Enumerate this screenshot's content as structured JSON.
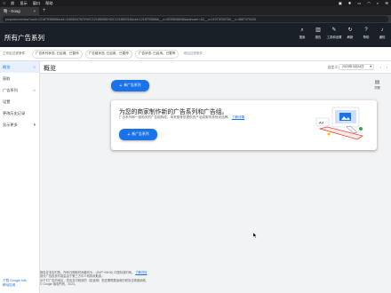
{
  "menubar": {
    "items": [
      "前",
      "显示",
      "窗口",
      "帮助"
    ]
  },
  "browser": {
    "tab_title": "略 - Goog",
    "url": "ps/pvw/overview?ocid=1218793868&euid=11608347623%2C121880581%2C121882016&cid=1218793868&__c=4039848848&authuser=1&__u=1197303476&__c=4867470426"
  },
  "app": {
    "title": "所有广告系列"
  },
  "toolbar": {
    "items": [
      {
        "icon": "search-icon",
        "label": "搜索"
      },
      {
        "icon": "reports-icon",
        "label": "报告"
      },
      {
        "icon": "tools-icon",
        "label": "工具和设置"
      },
      {
        "icon": "refresh-icon",
        "label": "刷新"
      },
      {
        "icon": "help-icon",
        "label": "帮助"
      },
      {
        "icon": "notifications-icon",
        "label": "通知"
      }
    ]
  },
  "filters": {
    "label": "工作区过滤条件",
    "chips": [
      "广告系列状态: 已启用、已暂停",
      "广告组状态: 已启用、已暂停",
      "广告状态: 已启用、已暂停"
    ],
    "add_label": "添加过滤条件"
  },
  "sidebar": {
    "items": [
      {
        "label": "概览",
        "active": true,
        "icon": "home-icon"
      },
      {
        "label": "获取",
        "active": false,
        "icon": ""
      },
      {
        "label": "广告系列",
        "active": false,
        "icon": "campaigns-icon"
      },
      {
        "label": "设置",
        "active": false,
        "icon": ""
      },
      {
        "label": "更改历史记录",
        "active": false,
        "icon": ""
      },
      {
        "label": "显示更多",
        "active": false,
        "icon": "chevron-down-icon"
      }
    ],
    "footer": [
      "下载 Google Ads",
      "移动应用"
    ]
  },
  "main": {
    "title": "概览",
    "date_label": "自定义",
    "date_value": "2023年3月24日",
    "new_campaign_label": "新广告系列",
    "insight_label": "洞察"
  },
  "card": {
    "title": "为您的商家制作新的广告系列和广告组。",
    "desc": "广告系列和一组相关的广告组构成，用来推荐您提供的产品或服务类别或品牌。",
    "link": "了解详情",
    "button": "新广告系列"
  },
  "footer": {
    "line1": "报告并非实时的。所有日期和时间都均为：(GMT+08:00) 中国标准时间。",
    "line1_link": "了解详情",
    "line2": "部分广告投放可能会由于第三方中介机构收取费。",
    "line3": "对于打广告的地区，您应支付税费的（如适用）您还需根据适用的税务法规缴纳税。",
    "line4": "© Google 版权所有，2023。"
  },
  "colors": {
    "accent": "#1a73e8",
    "header_bg": "#1a2027"
  }
}
